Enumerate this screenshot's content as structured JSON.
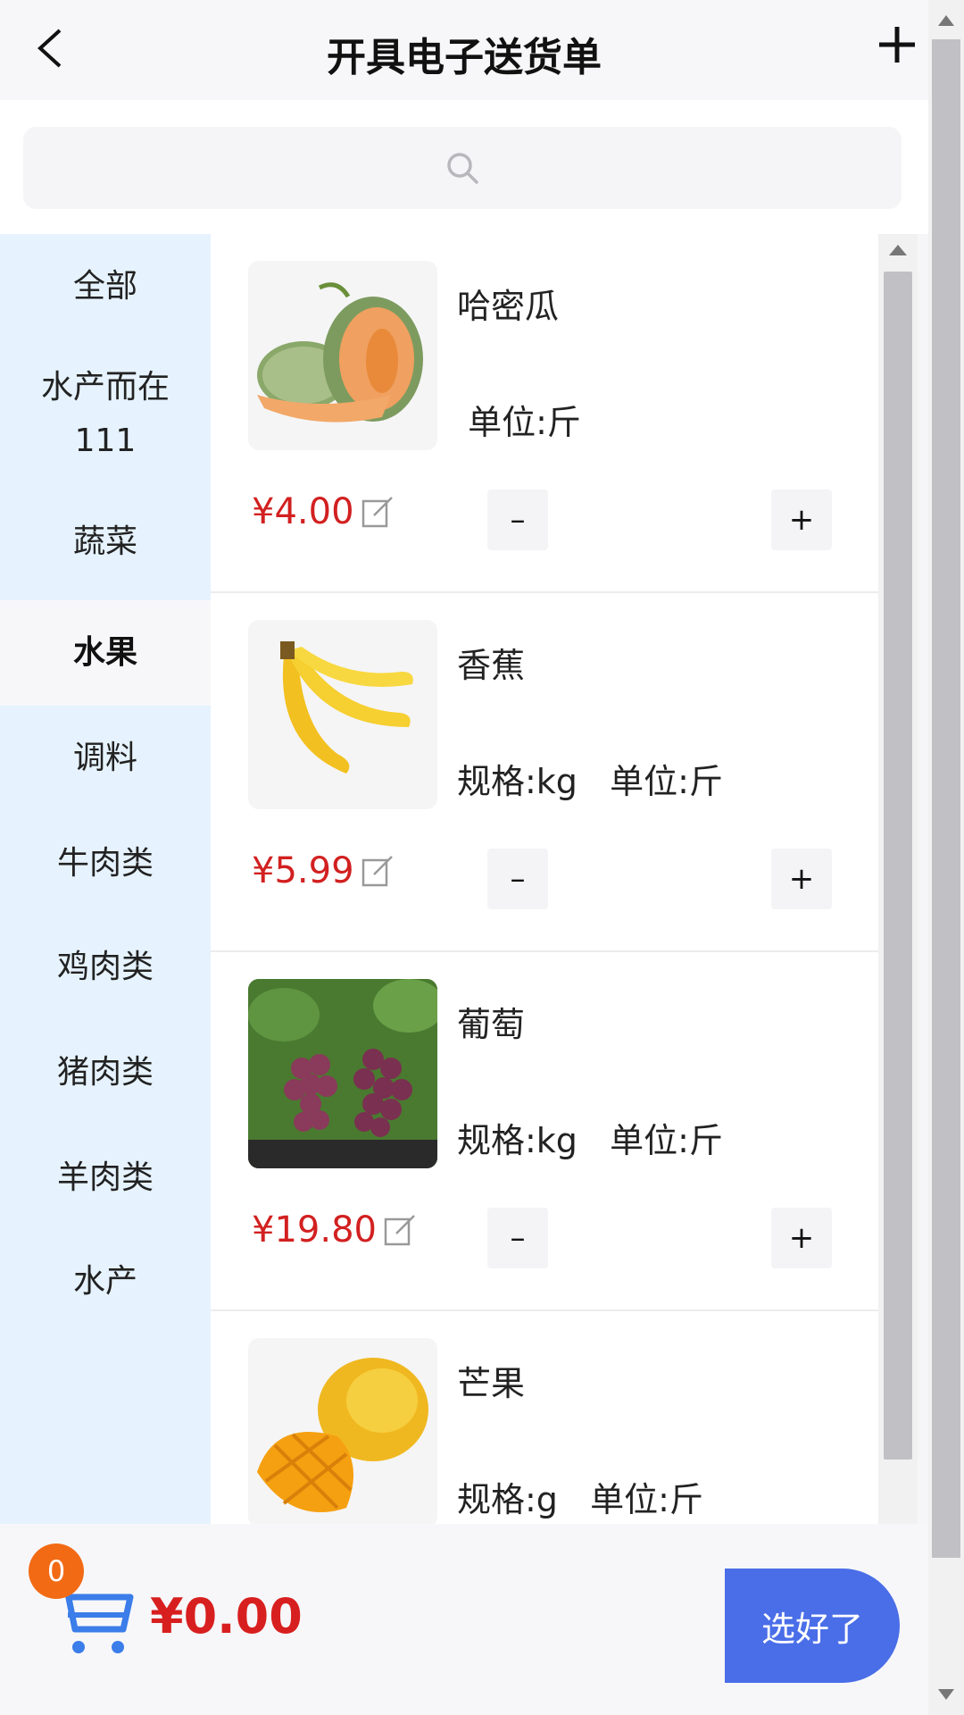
{
  "header": {
    "title": "开具电子送货单"
  },
  "search": {
    "placeholder": ""
  },
  "categories": [
    {
      "label": "全部"
    },
    {
      "label": "水产而在\n111"
    },
    {
      "label": "蔬菜"
    },
    {
      "label": "水果",
      "active": true
    },
    {
      "label": "调料"
    },
    {
      "label": "牛肉类"
    },
    {
      "label": "鸡肉类"
    },
    {
      "label": "猪肉类"
    },
    {
      "label": "羊肉类"
    },
    {
      "label": "水产"
    }
  ],
  "products": [
    {
      "name": "哈密瓜",
      "spec": " 单位:斤",
      "price": "¥4.00",
      "image": "cantaloupe"
    },
    {
      "name": "香蕉",
      "spec": "规格:kg   单位:斤",
      "price": "¥5.99",
      "image": "banana"
    },
    {
      "name": "葡萄",
      "spec": "规格:kg   单位:斤",
      "price": "¥19.80",
      "image": "grapes"
    },
    {
      "name": "芒果",
      "spec": "规格:g   单位:斤",
      "price": "",
      "image": "mango"
    }
  ],
  "quantity_buttons": {
    "minus": "–",
    "plus": "+"
  },
  "cart": {
    "count": "0",
    "total": "¥0.00"
  },
  "actions": {
    "done_label": "选好了"
  },
  "colors": {
    "price": "#d22020",
    "accent": "#4a6ee8",
    "badge": "#f26a14",
    "sidebar": "#e6f3fe",
    "cart_icon": "#3b7de9"
  }
}
